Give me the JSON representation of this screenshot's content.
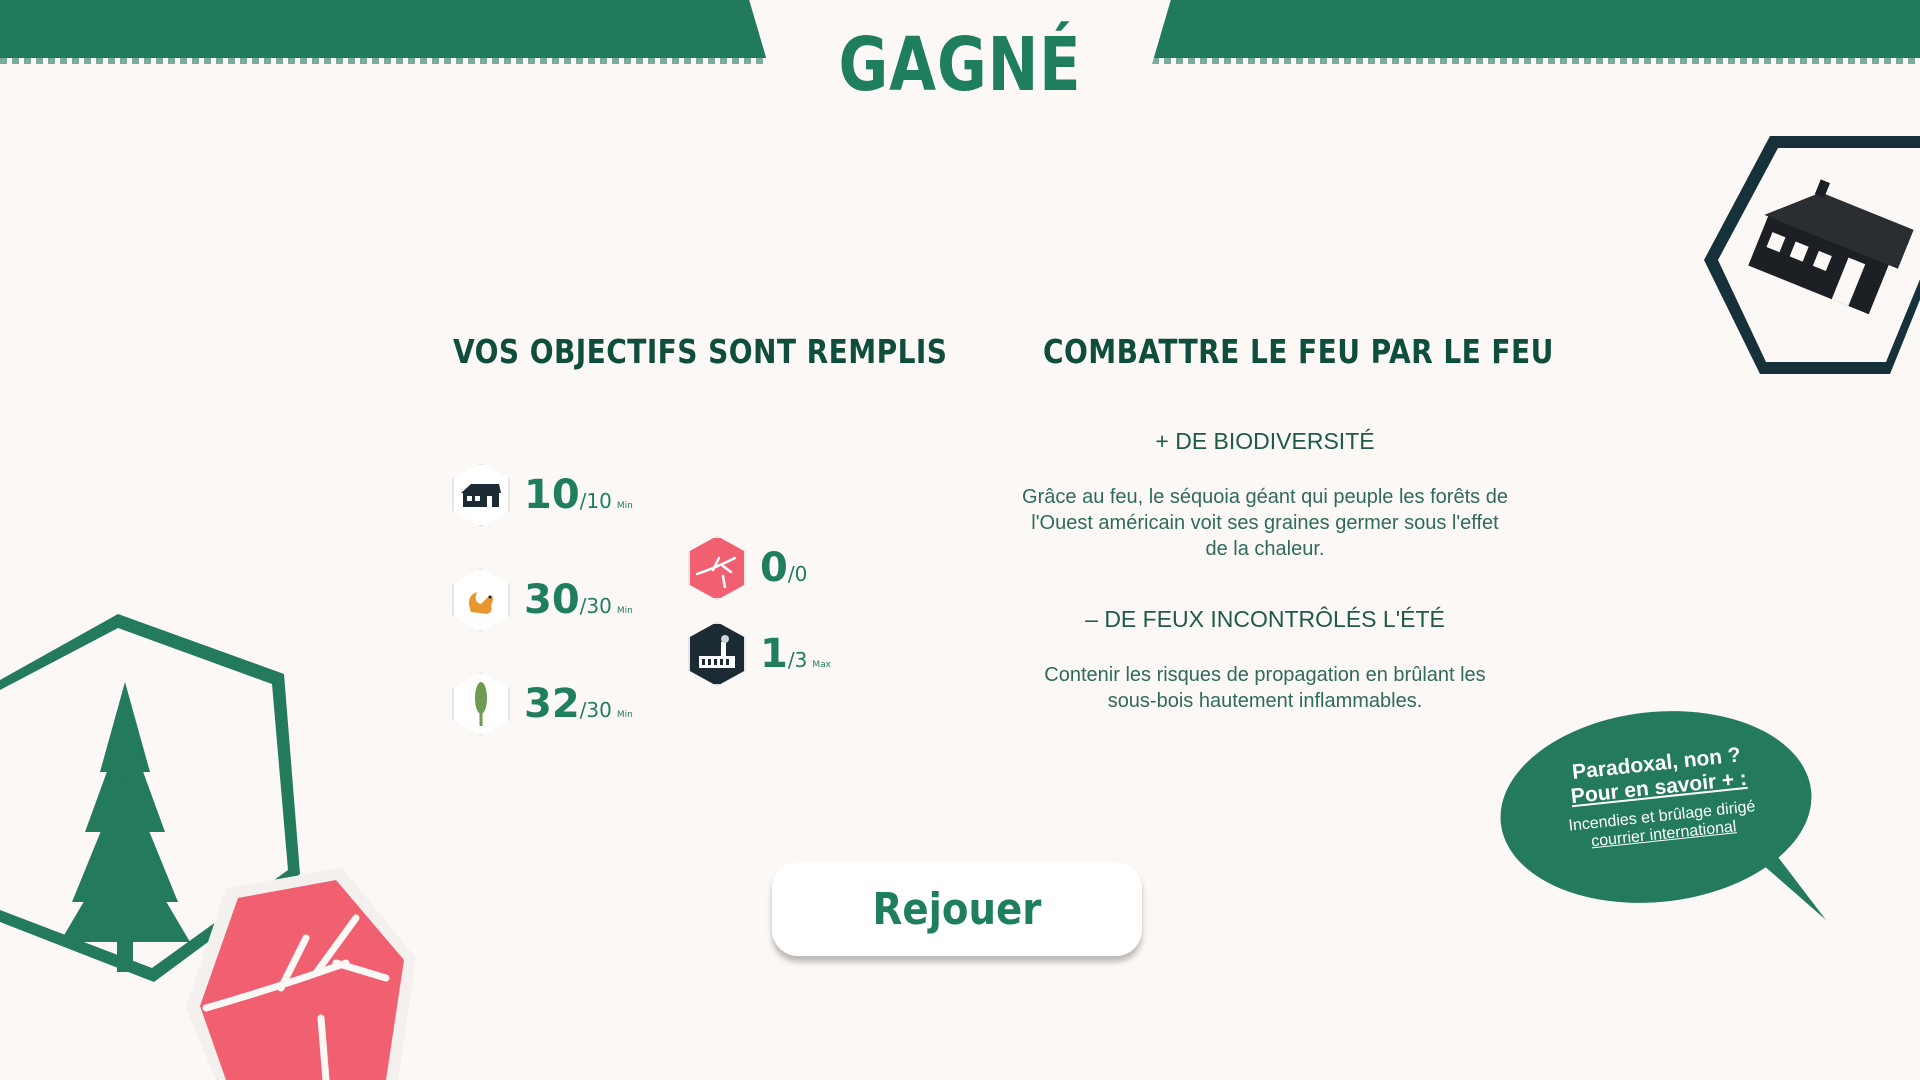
{
  "header": {
    "title": "GAGNÉ"
  },
  "left_panel": {
    "heading": "VOS OBJECTIFS SONT REMPLIS",
    "objectives": [
      {
        "icon": "house-icon",
        "value": "10",
        "target": "/10",
        "unit": "Min"
      },
      {
        "icon": "squirrel-icon",
        "value": "30",
        "target": "/30",
        "unit": "Min"
      },
      {
        "icon": "sequoia-icon",
        "value": "32",
        "target": "/30",
        "unit": "Min"
      },
      {
        "icon": "burnt-tree-icon",
        "value": "0",
        "target": "/0",
        "unit": ""
      },
      {
        "icon": "factory-icon",
        "value": "1",
        "target": "/3",
        "unit": "Max"
      }
    ]
  },
  "right_panel": {
    "heading": "COMBATTRE LE FEU PAR LE FEU",
    "section1_title": "+ DE BIODIVERSITÉ",
    "section1_text": "Grâce au feu, le séquoia géant qui peuple les forêts de l'Ouest américain voit ses graines germer sous l'effet de la chaleur.",
    "section2_title": "– DE FEUX INCONTRÔLÉS L'ÉTÉ",
    "section2_text": "Contenir les risques de propagation en brûlant les sous-bois hautement inflammables."
  },
  "replay_button": {
    "label": "Rejouer"
  },
  "bubble": {
    "line1": "Paradoxal, non ?",
    "line2": "Pour en savoir + :",
    "line3": "Incendies et brûlage dirigé",
    "link": "courrier international"
  },
  "colors": {
    "accent": "#217a5c",
    "dark_green": "#0f4d3c",
    "red": "#f06070",
    "background": "#fcf8f5"
  }
}
